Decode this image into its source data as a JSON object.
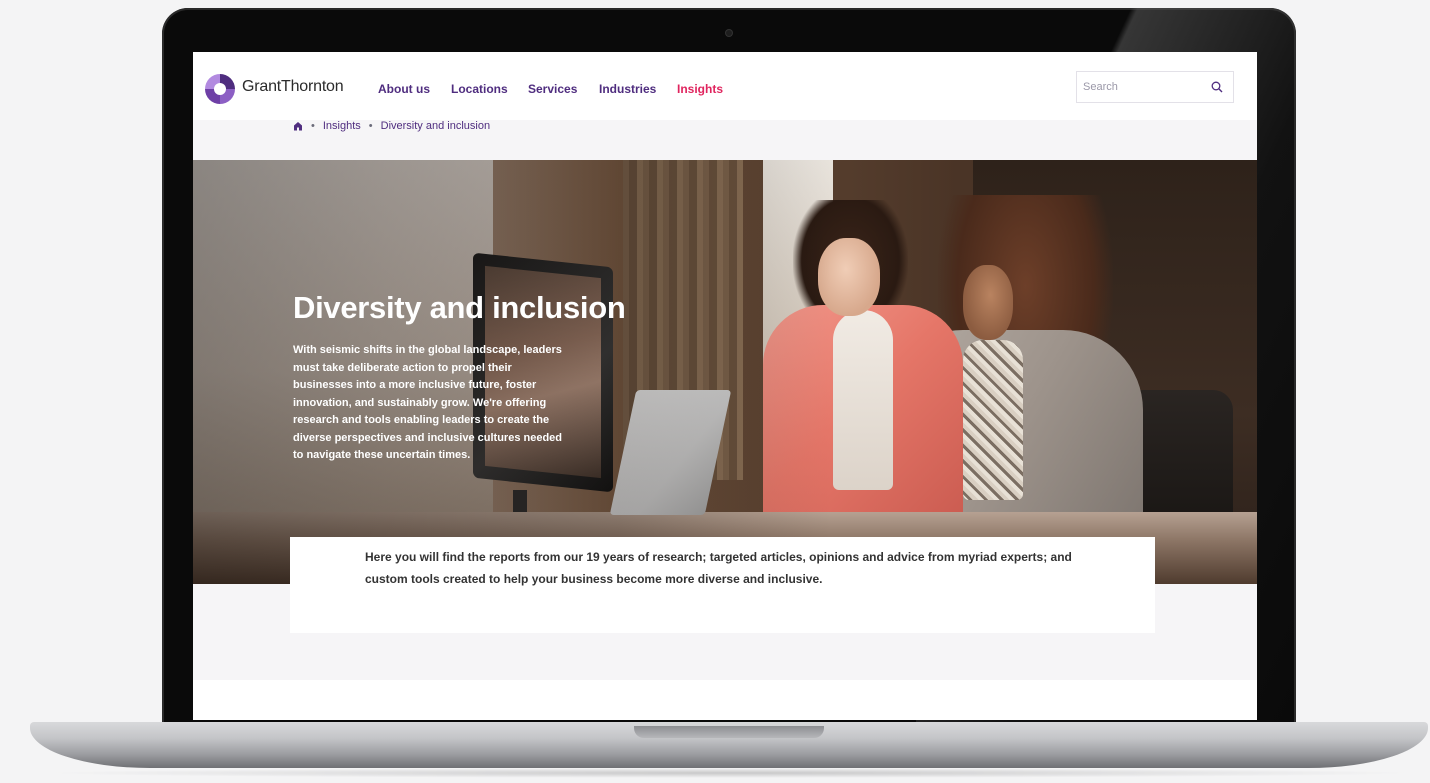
{
  "site": {
    "logo_text": "GrantThornton"
  },
  "nav": {
    "items": [
      {
        "label": "About us"
      },
      {
        "label": "Locations"
      },
      {
        "label": "Services"
      },
      {
        "label": "Industries"
      },
      {
        "label": "Insights",
        "active": true
      }
    ],
    "active_color": "#e0245e",
    "link_color": "#4f2d7f"
  },
  "search": {
    "placeholder": "Search",
    "icon": "search-icon"
  },
  "breadcrumb": {
    "home_icon": "home-icon",
    "items": [
      "Insights",
      "Diversity and inclusion"
    ],
    "separator": "•"
  },
  "hero": {
    "title": "Diversity and inclusion",
    "description": "With seismic shifts in the global landscape, leaders must take deliberate action to propel their businesses into a more inclusive future, foster innovation, and sustainably grow. We're offering research and tools enabling leaders to create the diverse perspectives and inclusive cultures needed to navigate these uncertain times."
  },
  "intro": {
    "text": "Here you will find the reports from our 19 years of research; targeted articles, opinions and advice from myriad experts; and custom tools created to help your business become more diverse and inclusive."
  }
}
